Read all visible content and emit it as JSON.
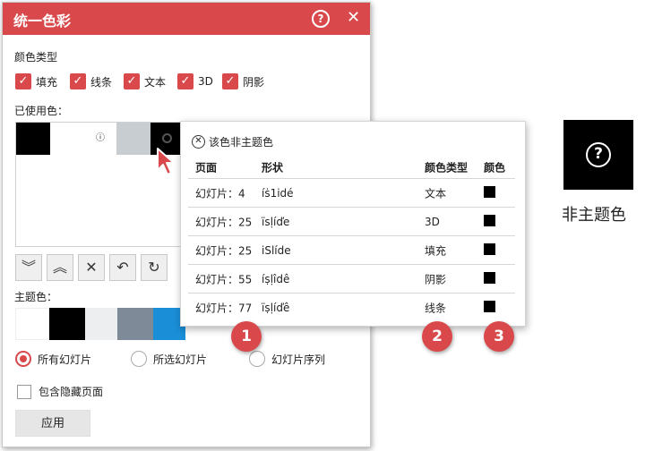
{
  "dialog": {
    "title": "统一色彩",
    "help_glyph": "?",
    "close_glyph": "✕",
    "color_type_label": "颜色类型",
    "color_types": [
      "填充",
      "线条",
      "文本",
      "3D",
      "阴影"
    ],
    "used_colors_label": "已使用色：",
    "used_swatches": [
      "#000000",
      "#ffffff",
      "#ffffff",
      "#c8cdd2",
      "#000000"
    ],
    "tools": [
      "chevrons-down",
      "chevrons-up",
      "close",
      "undo",
      "refresh"
    ],
    "tool_glyphs": [
      "︾",
      "︽",
      "✕",
      "↶",
      "↻"
    ],
    "theme_colors_label": "主题色：",
    "theme_swatches": [
      "#ffffff",
      "#000000",
      "#eceef0",
      "#7e8a97",
      "#1a8fd8"
    ],
    "scope_options": [
      "所有幻灯片",
      "所选幻灯片",
      "幻灯片序列"
    ],
    "include_hidden_label": "包含隐藏页面",
    "apply_label": "应用"
  },
  "popup": {
    "heading": "该色非主题色",
    "headers": {
      "page": "页面",
      "shape": "形状",
      "type": "颜色类型",
      "color": "颜色"
    },
    "rows": [
      {
        "page": "幻灯片：4",
        "shape": "íṡ1idé",
        "type": "文本"
      },
      {
        "page": "幻灯片：25",
        "shape": "ïsḷíďe",
        "type": "3D"
      },
      {
        "page": "幻灯片：25",
        "shape": "iSlíde",
        "type": "填充"
      },
      {
        "page": "幻灯片：55",
        "shape": "íṣḷîdê",
        "type": "阴影"
      },
      {
        "page": "幻灯片：77",
        "shape": "ïṣḷíďê",
        "type": "线条"
      }
    ],
    "swatch_color": "#000000"
  },
  "badges": [
    "1",
    "2",
    "3"
  ],
  "legend": {
    "label": "非主题色",
    "glyph": "?"
  },
  "accent": "#d9484a"
}
